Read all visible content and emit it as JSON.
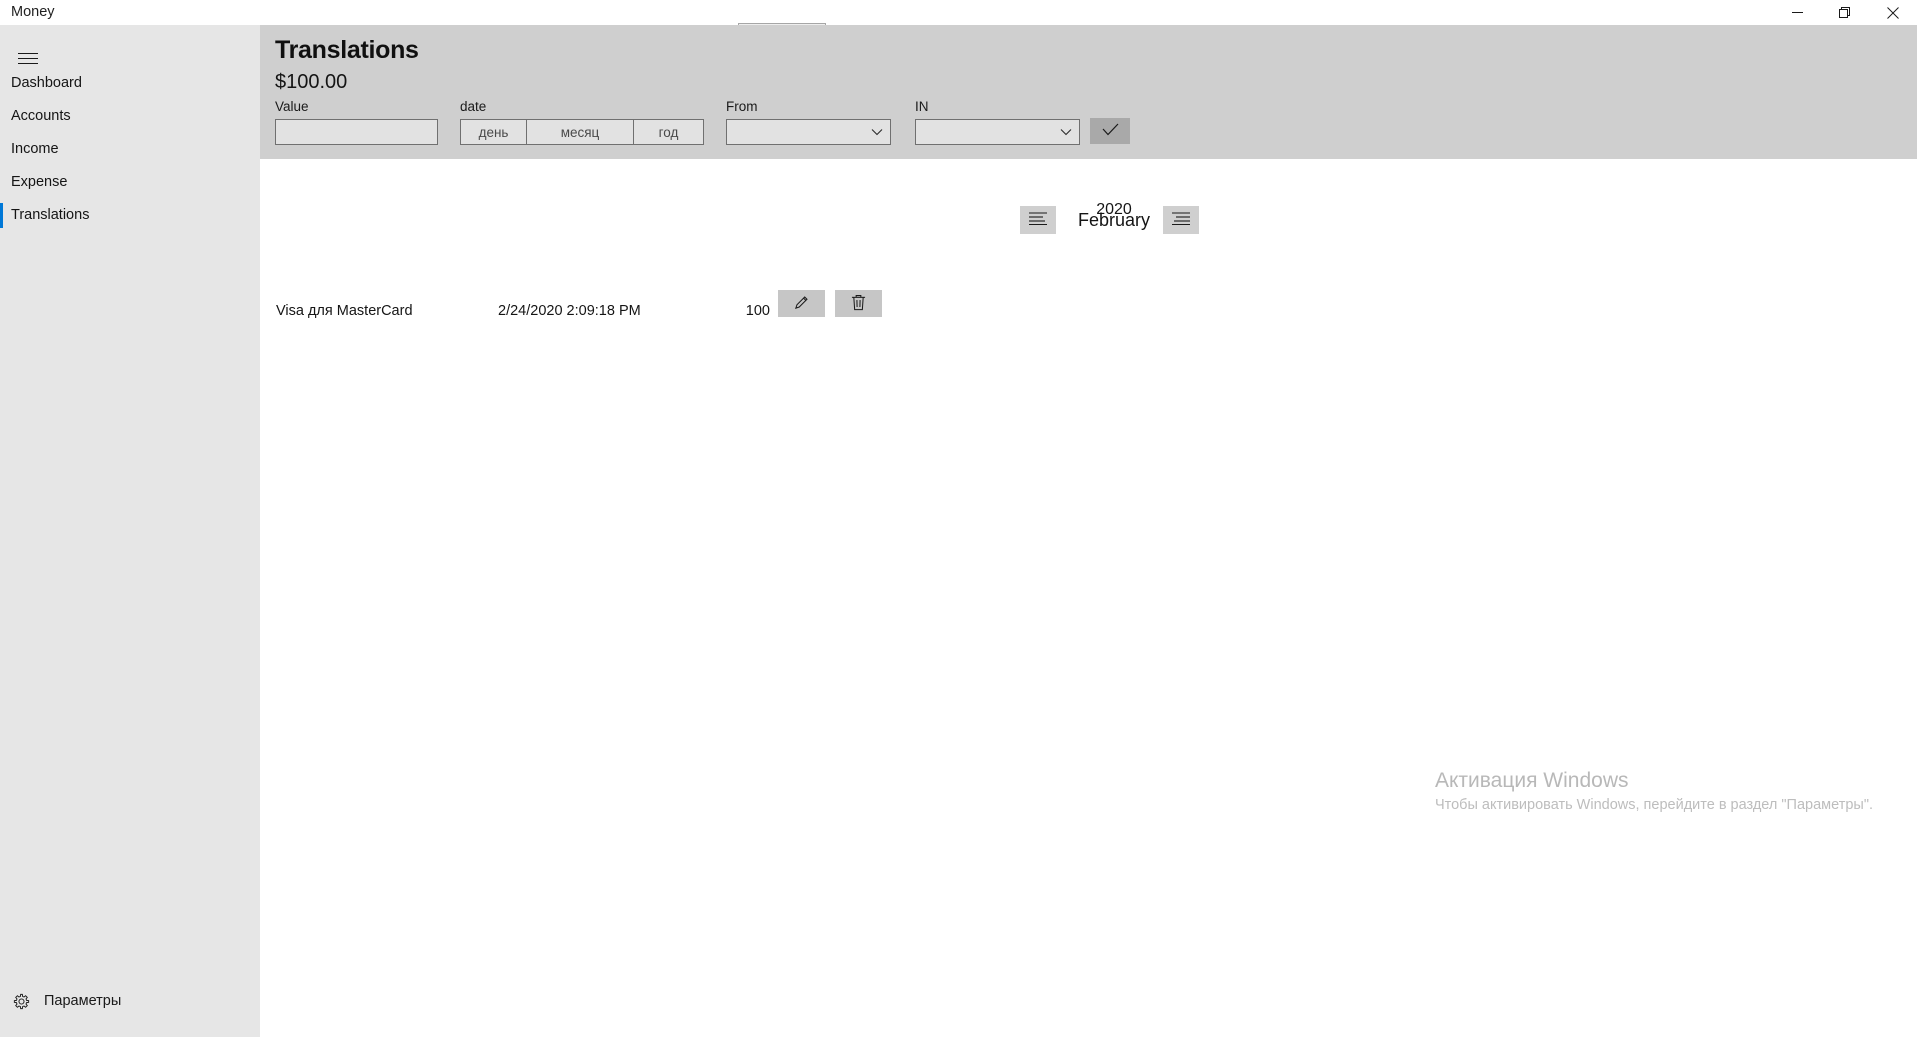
{
  "window": {
    "app_title": "Money",
    "controls": {
      "minimize": "minimize-icon",
      "restore": "restore-icon",
      "close": "close-icon"
    },
    "grip": "drag-handle"
  },
  "sidebar": {
    "menu_icon": "hamburger-icon",
    "items": [
      {
        "label": "Dashboard",
        "selected": false
      },
      {
        "label": "Accounts",
        "selected": false
      },
      {
        "label": "Income",
        "selected": false
      },
      {
        "label": "Expense",
        "selected": false
      },
      {
        "label": "Translations",
        "selected": true
      }
    ],
    "settings": {
      "label": "Параметры",
      "icon": "gear-icon"
    },
    "accent_color": "#0078d7"
  },
  "header": {
    "title": "Translations",
    "amount": "$100.00"
  },
  "form": {
    "value": {
      "label": "Value",
      "text": "",
      "placeholder": ""
    },
    "date": {
      "label": "date",
      "day": {
        "text": "",
        "placeholder": "день"
      },
      "month": {
        "text": "",
        "placeholder": "месяц"
      },
      "year": {
        "text": "",
        "placeholder": "год"
      }
    },
    "from": {
      "label": "From",
      "selected": "",
      "arrow_icon": "chevron-down-icon"
    },
    "in": {
      "label": "IN",
      "selected": "",
      "arrow_icon": "chevron-down-icon"
    },
    "confirm": {
      "icon": "checkmark-icon",
      "label": ""
    }
  },
  "month_nav": {
    "prev_icon": "align-left-icon",
    "next_icon": "align-right-icon",
    "year": "2020",
    "month": "February"
  },
  "transactions": [
    {
      "name": "Visa для MasterCard",
      "date": "2/24/2020 2:09:18 PM",
      "amount": "100",
      "edit_icon": "pencil-icon",
      "delete_icon": "trash-icon"
    }
  ],
  "watermark": {
    "title": "Активация Windows",
    "subtitle": "Чтобы активировать Windows, перейдите в раздел \"Параметры\"."
  }
}
